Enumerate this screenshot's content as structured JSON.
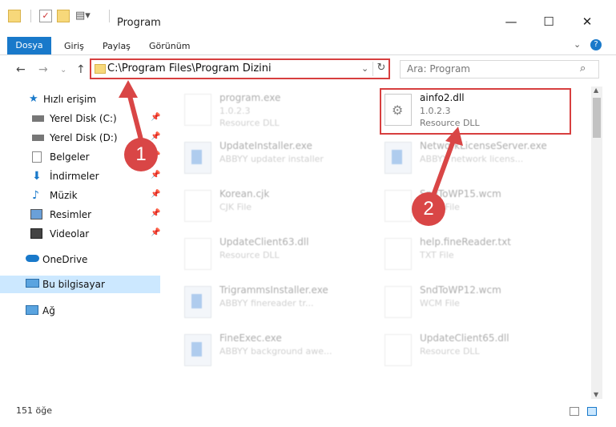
{
  "window": {
    "title": "Program",
    "minimize_icon": "minimize-icon",
    "maximize_icon": "maximize-icon",
    "close_icon": "close-icon"
  },
  "ribbon": {
    "tabs": [
      "Dosya",
      "Giriş",
      "Paylaş",
      "Görünüm"
    ],
    "help_icon": "?"
  },
  "address": {
    "path": "C:\\Program Files\\Program Dizini",
    "search_placeholder": "Ara: Program"
  },
  "sidebar": {
    "items": [
      {
        "label": "Hızlı erişim",
        "icon": "star-icon"
      },
      {
        "label": "Yerel Disk (C:)",
        "icon": "drive-icon",
        "pinned": true
      },
      {
        "label": "Yerel Disk (D:)",
        "icon": "drive-icon",
        "pinned": true
      },
      {
        "label": "Belgeler",
        "icon": "documents-icon",
        "pinned": true
      },
      {
        "label": "İndirmeler",
        "icon": "download-icon",
        "pinned": true
      },
      {
        "label": "Müzik",
        "icon": "music-icon",
        "pinned": true
      },
      {
        "label": "Resimler",
        "icon": "pictures-icon",
        "pinned": true
      },
      {
        "label": "Videolar",
        "icon": "videos-icon",
        "pinned": true
      },
      {
        "label": "OneDrive",
        "icon": "cloud-icon"
      },
      {
        "label": "Bu bilgisayar",
        "icon": "computer-icon",
        "selected": true
      },
      {
        "label": "Ağ",
        "icon": "network-icon"
      }
    ]
  },
  "files": [
    {
      "name": "program.exe",
      "line2": "1.0.2.3",
      "line3": "Resource DLL"
    },
    {
      "name": "ainfo2.dll",
      "line2": "1.0.2.3",
      "line3": "Resource DLL"
    },
    {
      "name": "UpdateInstaller.exe",
      "line2": "ABBYY updater installer",
      "line3": ""
    },
    {
      "name": "NetworkLicenseServer.exe",
      "line2": "ABBYY network licens...",
      "line3": ""
    },
    {
      "name": "Korean.cjk",
      "line2": "CJK File",
      "line3": ""
    },
    {
      "name": "SndToWP15.wcm",
      "line2": "WCM File",
      "line3": ""
    },
    {
      "name": "UpdateClient63.dll",
      "line2": "Resource DLL",
      "line3": ""
    },
    {
      "name": "help.fineReader.txt",
      "line2": "TXT File",
      "line3": ""
    },
    {
      "name": "TrigrammsInstaller.exe",
      "line2": "ABBYY finereader tr...",
      "line3": ""
    },
    {
      "name": "SndToWP12.wcm",
      "line2": "WCM File",
      "line3": ""
    },
    {
      "name": "FineExec.exe",
      "line2": "ABBYY background awe...",
      "line3": ""
    },
    {
      "name": "UpdateClient65.dll",
      "line2": "Resource DLL",
      "line3": ""
    }
  ],
  "status": {
    "count": "151 öğe"
  },
  "annotations": {
    "step1": "1",
    "step2": "2",
    "color": "#d73f3f"
  }
}
